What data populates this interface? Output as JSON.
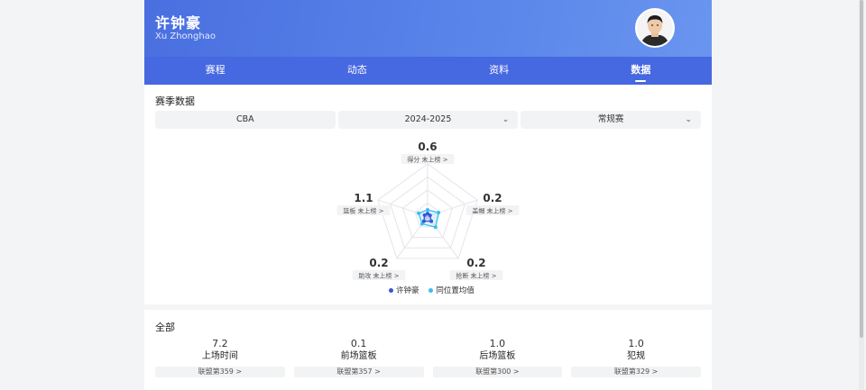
{
  "player": {
    "name": "许钟豪",
    "name_en": "Xu Zhonghao"
  },
  "tabs": [
    {
      "label": "赛程",
      "active": false
    },
    {
      "label": "动态",
      "active": false
    },
    {
      "label": "资料",
      "active": false
    },
    {
      "label": "数据",
      "active": true
    }
  ],
  "season": {
    "title": "赛季数据",
    "filters": [
      {
        "value": "CBA",
        "dropdown": false
      },
      {
        "value": "2024-2025",
        "dropdown": true
      },
      {
        "value": "常规赛",
        "dropdown": true
      }
    ]
  },
  "radar": {
    "axes": [
      {
        "label": "得分",
        "value": "0.6",
        "rank": "未上榜 >"
      },
      {
        "label": "盖帽",
        "value": "0.2",
        "rank": "未上榜 >"
      },
      {
        "label": "抢断",
        "value": "0.2",
        "rank": "未上榜 >"
      },
      {
        "label": "助攻",
        "value": "0.2",
        "rank": "未上榜 >"
      },
      {
        "label": "篮板",
        "value": "1.1",
        "rank": "未上榜 >"
      }
    ],
    "player_fraction": [
      0.05,
      0.05,
      0.12,
      0.12,
      0.06
    ],
    "average_fraction": [
      0.12,
      0.22,
      0.26,
      0.18,
      0.18
    ],
    "colors": {
      "player": "#3a55d4",
      "average": "#3bbdee",
      "grid": "#e3e5ea"
    },
    "legend": {
      "player": "许钟豪",
      "average": "同位置均值"
    }
  },
  "overall": {
    "title": "全部",
    "stats": [
      {
        "value": "7.2",
        "label": "上场时间",
        "rank": "联盟第359 >"
      },
      {
        "value": "0.1",
        "label": "前场篮板",
        "rank": "联盟第357 >"
      },
      {
        "value": "1.0",
        "label": "后场篮板",
        "rank": "联盟第300 >"
      },
      {
        "value": "1.0",
        "label": "犯规",
        "rank": "联盟第329 >"
      }
    ]
  }
}
